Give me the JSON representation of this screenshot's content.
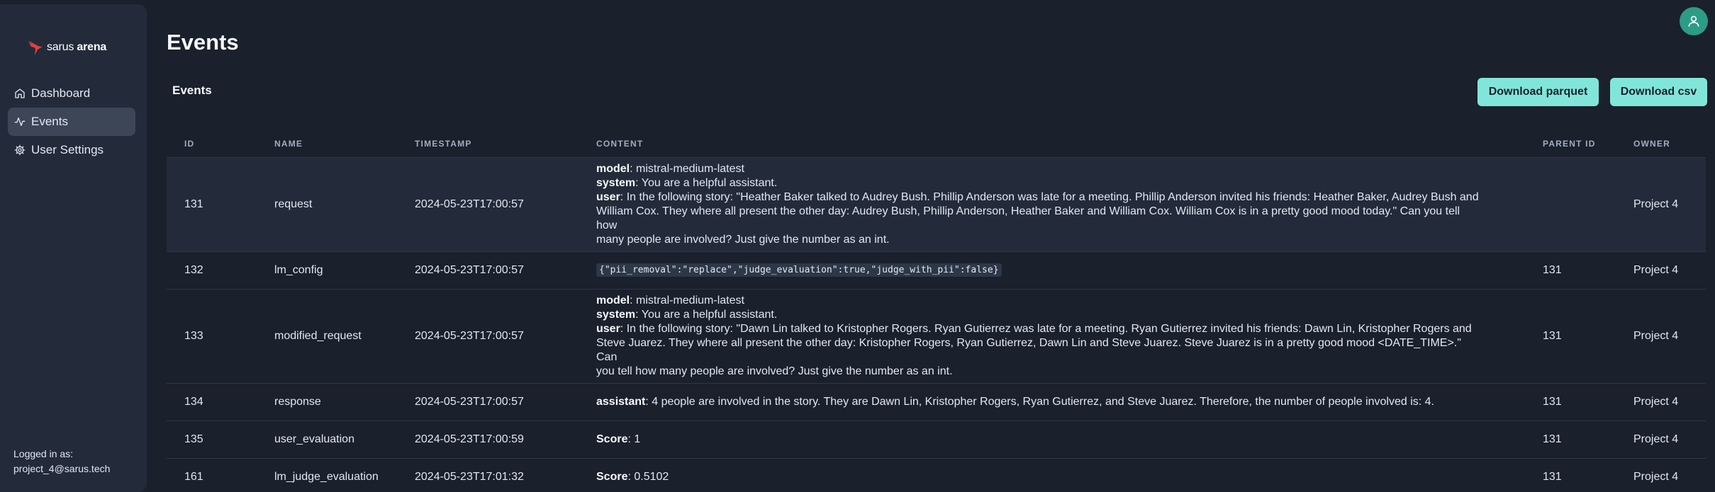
{
  "brand": {
    "name_light": "sarus",
    "name_bold": "arena"
  },
  "sidebar": {
    "items": [
      {
        "label": "Dashboard",
        "icon": "home-icon",
        "active": false
      },
      {
        "label": "Events",
        "icon": "activity-icon",
        "active": true
      },
      {
        "label": "User Settings",
        "icon": "gear-icon",
        "active": false
      }
    ],
    "login_label": "Logged in as:",
    "login_user": "project_4@sarus.tech"
  },
  "header": {
    "title": "Events",
    "avatar_icon": "user-icon"
  },
  "section": {
    "title": "Events",
    "download_parquet_label": "Download parquet",
    "download_csv_label": "Download csv"
  },
  "table": {
    "columns": [
      "ID",
      "NAME",
      "TIMESTAMP",
      "CONTENT",
      "PARENT ID",
      "OWNER"
    ],
    "rows": [
      {
        "id": "131",
        "name": "request",
        "timestamp": "2024-05-23T17:00:57",
        "model_key": "model",
        "model": "mistral-medium-latest",
        "system_key": "system",
        "system": "You are a helpful assistant.",
        "user_key": "user",
        "user_lines": [
          "In the following story: \"Heather Baker talked to Audrey Bush. Phillip Anderson was late for a meeting. Phillip Anderson invited his friends: Heather Baker, Audrey Bush and",
          "William Cox. They where all present the other day: Audrey Bush, Phillip Anderson, Heather Baker and William Cox. William Cox is in a pretty good mood today.\" Can you tell how",
          "many people are involved? Just give the number as an int."
        ],
        "parent_id": "",
        "owner": "Project 4"
      },
      {
        "id": "132",
        "name": "lm_config",
        "timestamp": "2024-05-23T17:00:57",
        "code": "{\"pii_removal\":\"replace\",\"judge_evaluation\":true,\"judge_with_pii\":false}",
        "parent_id": "131",
        "owner": "Project 4"
      },
      {
        "id": "133",
        "name": "modified_request",
        "timestamp": "2024-05-23T17:00:57",
        "model_key": "model",
        "model": "mistral-medium-latest",
        "system_key": "system",
        "system": "You are a helpful assistant.",
        "user_key": "user",
        "user_lines": [
          "In the following story: \"Dawn Lin talked to Kristopher Rogers. Ryan Gutierrez was late for a meeting. Ryan Gutierrez invited his friends: Dawn Lin, Kristopher Rogers and",
          "Steve Juarez. They where all present the other day: Kristopher Rogers, Ryan Gutierrez, Dawn Lin and Steve Juarez. Steve Juarez is in a pretty good mood <DATE_TIME>.\" Can",
          "you tell how many people are involved? Just give the number as an int."
        ],
        "parent_id": "131",
        "owner": "Project 4"
      },
      {
        "id": "134",
        "name": "response",
        "timestamp": "2024-05-23T17:00:57",
        "assistant_key": "assistant",
        "assistant": "4 people are involved in the story. They are Dawn Lin, Kristopher Rogers, Ryan Gutierrez, and Steve Juarez. Therefore, the number of people involved is: 4.",
        "parent_id": "131",
        "owner": "Project 4"
      },
      {
        "id": "135",
        "name": "user_evaluation",
        "timestamp": "2024-05-23T17:00:59",
        "score_key": "Score",
        "score": "1",
        "parent_id": "131",
        "owner": "Project 4"
      },
      {
        "id": "161",
        "name": "lm_judge_evaluation",
        "timestamp": "2024-05-23T17:01:32",
        "score_key": "Score",
        "score": "0.5102",
        "parent_id": "131",
        "owner": "Project 4"
      }
    ]
  }
}
